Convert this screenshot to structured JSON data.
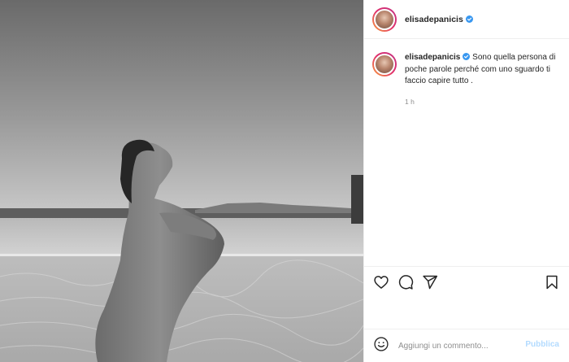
{
  "post": {
    "username": "elisadepanicis",
    "verified": true,
    "caption_username": "elisadepanicis",
    "caption_text": "Sono quella persona di poche parole perché com uno sguardo ti faccio capire tutto .",
    "time": "1 h",
    "photo_icon": "black-and-white-pool-photo"
  },
  "actions": {
    "like_icon": "heart-icon",
    "comment_icon": "comment-icon",
    "share_icon": "paper-plane-icon",
    "save_icon": "bookmark-icon"
  },
  "comment_box": {
    "emoji_icon": "smiley-icon",
    "placeholder": "Aggiungi un commento...",
    "publish_label": "Pubblica"
  },
  "colors": {
    "verified": "#3897f0",
    "publish_disabled": "#b3dbff",
    "muted_text": "#8e8e8e"
  }
}
